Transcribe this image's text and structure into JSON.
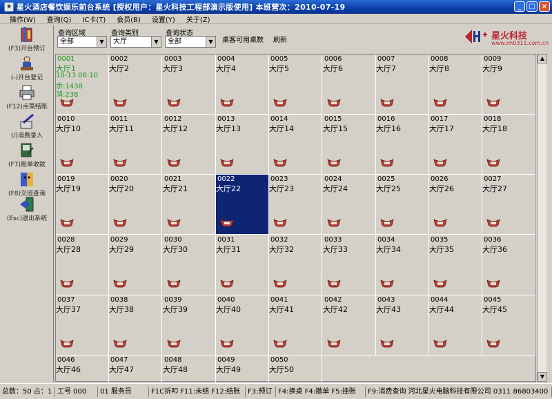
{
  "window": {
    "title": "星火酒店餐饮娱乐前台系统  [授权用户：星火科技工程部演示版使用]  本班营次：2010-07-19",
    "minimize": "_",
    "maximize": "□",
    "close": "×"
  },
  "menu": [
    "操作(W)",
    "查询(Q)",
    "IC卡(T)",
    "会员(B)",
    "设置(Y)",
    "关于(Z)"
  ],
  "sidebar": [
    {
      "label": "(F3)开台预订",
      "icon": "book-icon"
    },
    {
      "label": "(-)开台登记",
      "icon": "person-icon"
    },
    {
      "label": "(F12)点菜结账",
      "icon": "printer-icon"
    },
    {
      "label": "(/)消费录入",
      "icon": "edit-icon"
    },
    {
      "label": "(F7)账单收款",
      "icon": "document-icon"
    },
    {
      "label": "(F8)交班查询",
      "icon": "face-icon"
    },
    {
      "label": "(Esc)退出系统",
      "icon": "exit-icon"
    }
  ],
  "filters": {
    "area_label": "查询区域",
    "area_value": "全部",
    "type_label": "查询类别",
    "type_value": "大厅",
    "state_label": "查询状态",
    "state_value": "全部",
    "avail_label": "桌客可用桌数",
    "refresh_label": "刷新"
  },
  "logo": {
    "brand": "星火科技",
    "url": "www.xh0311.com.cn"
  },
  "tables": [
    {
      "num": "0001",
      "name": "大厅1",
      "occupied": true,
      "info": [
        "10-13 08:10",
        "余:1438",
        "消:238"
      ]
    },
    {
      "num": "0002",
      "name": "大厅2"
    },
    {
      "num": "0003",
      "name": "大厅3"
    },
    {
      "num": "0004",
      "name": "大厅4"
    },
    {
      "num": "0005",
      "name": "大厅5"
    },
    {
      "num": "0006",
      "name": "大厅6"
    },
    {
      "num": "0007",
      "name": "大厅7"
    },
    {
      "num": "0008",
      "name": "大厅8"
    },
    {
      "num": "0009",
      "name": "大厅9"
    },
    {
      "num": "0010",
      "name": "大厅10"
    },
    {
      "num": "0011",
      "name": "大厅11"
    },
    {
      "num": "0012",
      "name": "大厅12"
    },
    {
      "num": "0013",
      "name": "大厅13"
    },
    {
      "num": "0014",
      "name": "大厅14"
    },
    {
      "num": "0015",
      "name": "大厅15"
    },
    {
      "num": "0016",
      "name": "大厅16"
    },
    {
      "num": "0017",
      "name": "大厅17"
    },
    {
      "num": "0018",
      "name": "大厅18"
    },
    {
      "num": "0019",
      "name": "大厅19"
    },
    {
      "num": "0020",
      "name": "大厅20"
    },
    {
      "num": "0021",
      "name": "大厅21"
    },
    {
      "num": "0022",
      "name": "大厅22",
      "selected": true
    },
    {
      "num": "0023",
      "name": "大厅23"
    },
    {
      "num": "0024",
      "name": "大厅24"
    },
    {
      "num": "0025",
      "name": "大厅25"
    },
    {
      "num": "0026",
      "name": "大厅26"
    },
    {
      "num": "0027",
      "name": "大厅27"
    },
    {
      "num": "0028",
      "name": "大厅28"
    },
    {
      "num": "0029",
      "name": "大厅29"
    },
    {
      "num": "0030",
      "name": "大厅30"
    },
    {
      "num": "0031",
      "name": "大厅31"
    },
    {
      "num": "0032",
      "name": "大厅32"
    },
    {
      "num": "0033",
      "name": "大厅33"
    },
    {
      "num": "0034",
      "name": "大厅34"
    },
    {
      "num": "0035",
      "name": "大厅35"
    },
    {
      "num": "0036",
      "name": "大厅36"
    },
    {
      "num": "0037",
      "name": "大厅37"
    },
    {
      "num": "0038",
      "name": "大厅38"
    },
    {
      "num": "0039",
      "name": "大厅39"
    },
    {
      "num": "0040",
      "name": "大厅40"
    },
    {
      "num": "0041",
      "name": "大厅41"
    },
    {
      "num": "0042",
      "name": "大厅42"
    },
    {
      "num": "0043",
      "name": "大厅43"
    },
    {
      "num": "0044",
      "name": "大厅44"
    },
    {
      "num": "0045",
      "name": "大厅45"
    },
    {
      "num": "0046",
      "name": "大厅46"
    },
    {
      "num": "0047",
      "name": "大厅47"
    },
    {
      "num": "0048",
      "name": "大厅48"
    },
    {
      "num": "0049",
      "name": "大厅49"
    },
    {
      "num": "0050",
      "name": "大厅50"
    }
  ],
  "status": [
    "总数：50 占：1",
    "工号 000",
    "01 服务员",
    "F1C折叩 F11:未结 F12:结账",
    "F3:预订",
    "F4:换桌 F4:撤单 F5:挂账",
    "F9:消费查询 河北星火电脑科技有限公司 0311 86803400"
  ],
  "colors": {
    "selected": "#0e2574",
    "occupied_text": "#1a9a1a",
    "title_bar": "#0a3fa8",
    "logo": "#b8242e"
  }
}
